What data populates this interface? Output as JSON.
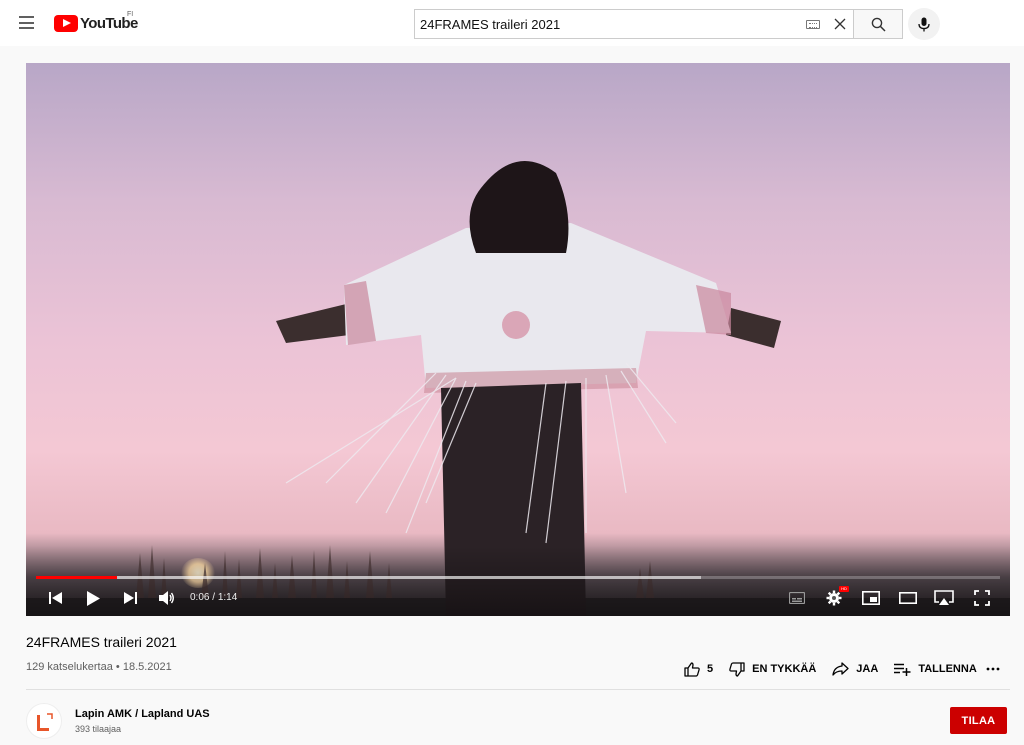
{
  "header": {
    "logo_text": "YouTube",
    "country_code": "FI",
    "search_value": "24FRAMES traileri 2021"
  },
  "player": {
    "current_time": "0:06",
    "separator": "/",
    "duration": "1:14",
    "played_fraction": 0.084,
    "loaded_fraction": 0.69
  },
  "video": {
    "title": "24FRAMES traileri 2021",
    "views": "129 katselukertaa",
    "dot": "•",
    "date": "18.5.2021"
  },
  "actions": {
    "like_count": "5",
    "dislike_label": "EN TYKKÄÄ",
    "share_label": "JAA",
    "save_label": "TALLENNA"
  },
  "channel": {
    "name": "Lapin AMK / Lapland UAS",
    "subscribers": "393 tilaajaa",
    "subscribe_label": "TILAA",
    "brand_color": "#e8562a"
  },
  "colors": {
    "accent": "#ff0000",
    "subscribe_bg": "#cc0000"
  }
}
